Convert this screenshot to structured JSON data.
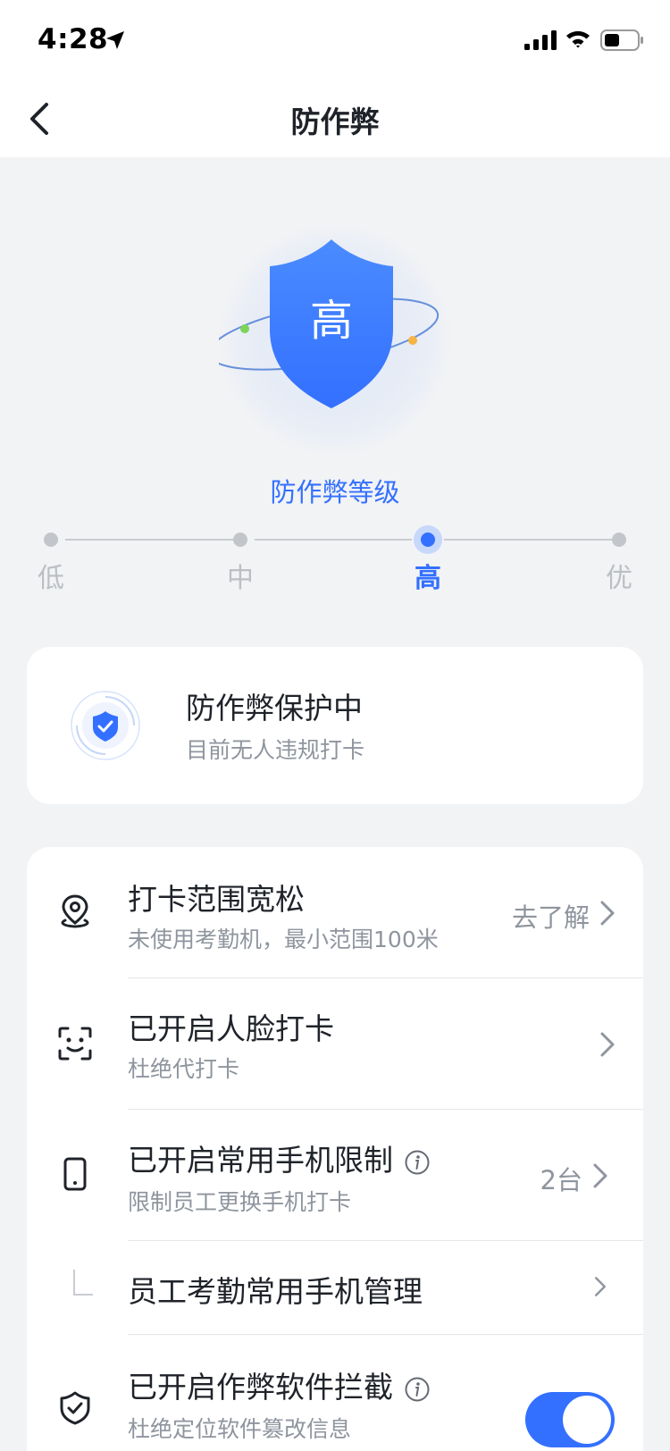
{
  "status_bar": {
    "time": "4:28"
  },
  "nav": {
    "title": "防作弊"
  },
  "shield": {
    "level_char": "高"
  },
  "level": {
    "title": "防作弊等级",
    "options": [
      "低",
      "中",
      "高",
      "优"
    ],
    "selected": "高"
  },
  "protection": {
    "title": "防作弊保护中",
    "subtitle": "目前无人违规打卡"
  },
  "settings": [
    {
      "title": "打卡范围宽松",
      "subtitle": "未使用考勤机，最小范围100米",
      "action": "去了解"
    },
    {
      "title": "已开启人脸打卡",
      "subtitle": "杜绝代打卡"
    },
    {
      "title": "已开启常用手机限制",
      "subtitle": "限制员工更换手机打卡",
      "action": "2台"
    },
    {
      "title": "员工考勤常用手机管理"
    },
    {
      "title": "已开启作弊软件拦截",
      "subtitle": "杜绝定位软件篡改信息",
      "toggle_on": true
    }
  ],
  "colors": {
    "accent": "#3370ff",
    "background": "#f2f3f5"
  }
}
